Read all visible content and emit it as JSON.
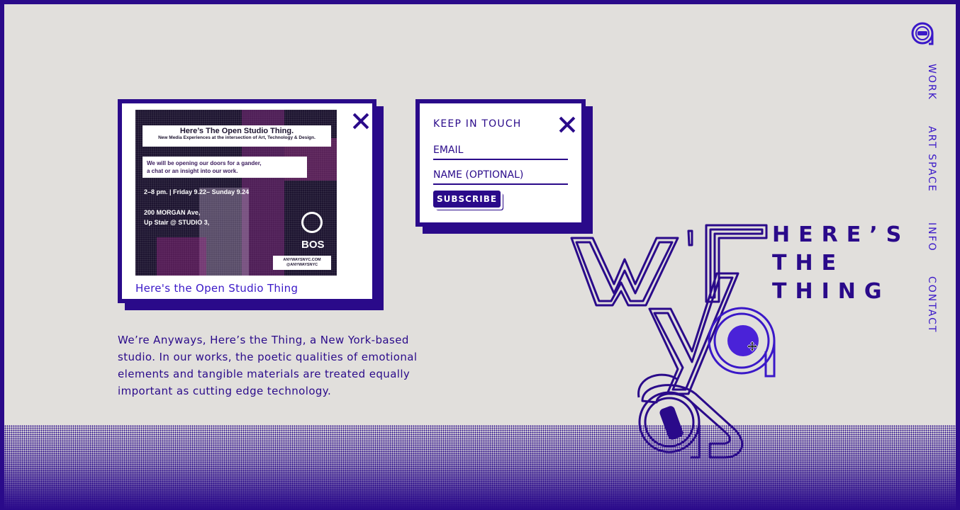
{
  "flyer_card": {
    "caption": "Here's the Open Studio Thing",
    "flyer": {
      "title": "Here’s The Open Studio Thing.",
      "subtitle": "New Media Experiences at the intersection of Art, Technology & Design.",
      "invite_line1": "We will be opening our doors for a gander,",
      "invite_line2": "a chat or an insight into our work.",
      "time": "2–8 pm. | Friday 9.22– Sunday 9.24",
      "address1": "200 MORGAN Ave,",
      "address2": "Up Stair @ STUDIO 3,",
      "bos": "BOS",
      "site": "ANYWAYSNYC.COM",
      "handle": "@ANYWAYSNYC"
    }
  },
  "newsletter": {
    "title": "KEEP IN TOUCH",
    "email_placeholder": "EMAIL",
    "name_placeholder": "NAME (OPTIONAL)",
    "subscribe_label": "SUBSCRIBE"
  },
  "about": {
    "text": "We’re Anyways, Here’s the Thing, a New York-based studio. In our works, the poetic qualities of emotional elements and tangible materials are treated equally important as cutting edge technology."
  },
  "nav": {
    "items": [
      "WORK",
      "ART SPACE",
      "INFO",
      "CONTACT"
    ]
  },
  "brand": {
    "tagline_line1": "HERE’S",
    "tagline_line2": "THE",
    "tagline_line3": "THING"
  },
  "colors": {
    "primary": "#2a0a8a",
    "accent": "#3a18c8",
    "background": "#e1dfdc"
  }
}
